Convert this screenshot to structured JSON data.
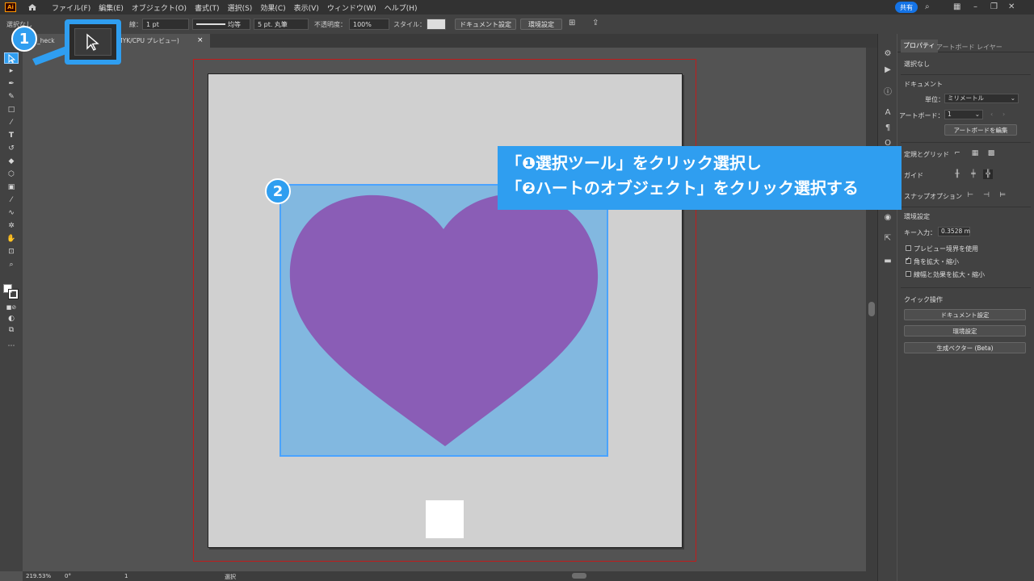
{
  "menubar": {
    "app_logo": "Ai",
    "items": [
      "ファイル(F)",
      "編集(E)",
      "オブジェクト(O)",
      "書式(T)",
      "選択(S)",
      "効果(C)",
      "表示(V)",
      "ウィンドウ(W)",
      "ヘルプ(H)"
    ],
    "share_label": "共有"
  },
  "controlbar": {
    "no_selection": "選択なし",
    "stroke_label": "線：",
    "stroke_weight": "1 pt",
    "stroke_profile": "均等",
    "brush": "5 pt. 丸筆",
    "opacity_label": "不透明度：",
    "opacity_value": "100%",
    "style_label": "スタイル：",
    "doc_setup_btn": "ドキュメント設定",
    "prefs_btn": "環境設定"
  },
  "tabs": {
    "doc_tab_left": "_ill_heck",
    "doc_tab_right": "% (CMYK/CPU プレビュー)",
    "close": "×"
  },
  "status": {
    "zoom": "219.53%",
    "rotate": "0°",
    "artboard_num": "1",
    "mode": "選択"
  },
  "panel": {
    "tabs": [
      "プロパティ",
      "アートボード",
      "レイヤー"
    ],
    "no_selection": "選択なし",
    "document_heading": "ドキュメント",
    "units_label": "単位：",
    "units_value": "ミリメートル",
    "artboard_label": "アートボード：",
    "artboard_value": "1",
    "edit_artboard_btn": "アートボードを編集",
    "rulers_grids": "定規とグリッド",
    "guides": "ガイド",
    "snap_options": "スナップオプション",
    "preferences_heading": "環境設定",
    "key_increment_label": "キー入力：",
    "key_increment_value": "0.3528 m",
    "preview_bounds": "プレビュー境界を使用",
    "scale_corners": "角を拡大・縮小",
    "scale_strokes": "線幅と効果を拡大・縮小",
    "quick_actions": "クイック操作",
    "doc_setup_btn": "ドキュメント設定",
    "prefs_btn": "環境設定",
    "gen_vector_btn": "生成ベクター (Beta)"
  },
  "annotations": {
    "badge1": "1",
    "badge2": "2",
    "line1": "「❶選択ツール」をクリック選択し",
    "line2": "「❷ハートのオブジェクト」をクリック選択する"
  },
  "colors": {
    "accent": "#2f9ef0",
    "heart": "#8a5db6",
    "selection_fill": "#82b8e0",
    "bleed": "#c21b1b"
  }
}
